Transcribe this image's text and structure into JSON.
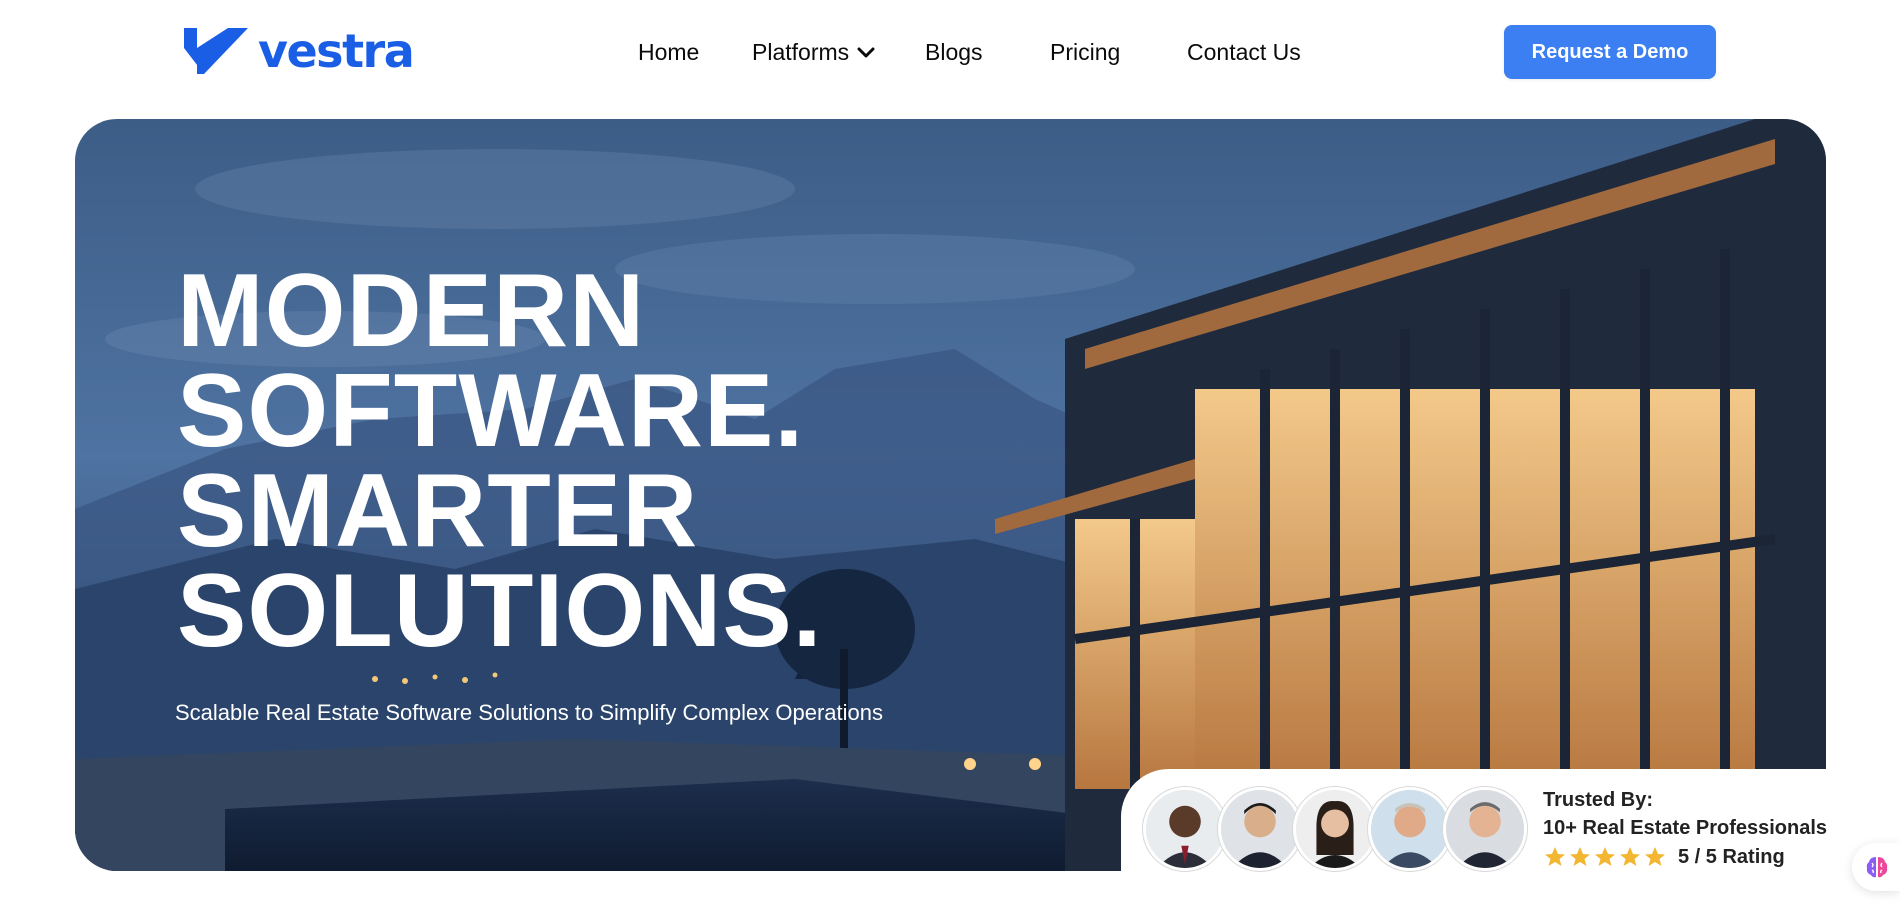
{
  "brand": {
    "name": "vestra",
    "color": "#1b5ee6"
  },
  "nav": {
    "items": [
      {
        "label": "Home"
      },
      {
        "label": "Platforms",
        "icon": "chevron-down-icon"
      },
      {
        "label": "Blogs"
      },
      {
        "label": "Pricing"
      },
      {
        "label": "Contact Us"
      }
    ]
  },
  "cta": {
    "label": "Request a Demo",
    "color": "#3b7ff2"
  },
  "hero": {
    "headline": [
      "MODERN",
      "SOFTWARE.",
      "SMARTER",
      "SOLUTIONS."
    ],
    "subtitle": "Scalable Real Estate Software Solutions to Simplify Complex Operations"
  },
  "trust": {
    "label": "Trusted By:",
    "count": "10+ Real Estate Professionals",
    "stars": 5,
    "rating": "5 / 5 Rating",
    "star_color": "#f2b632"
  },
  "widget": {
    "icon": "brain-icon"
  }
}
